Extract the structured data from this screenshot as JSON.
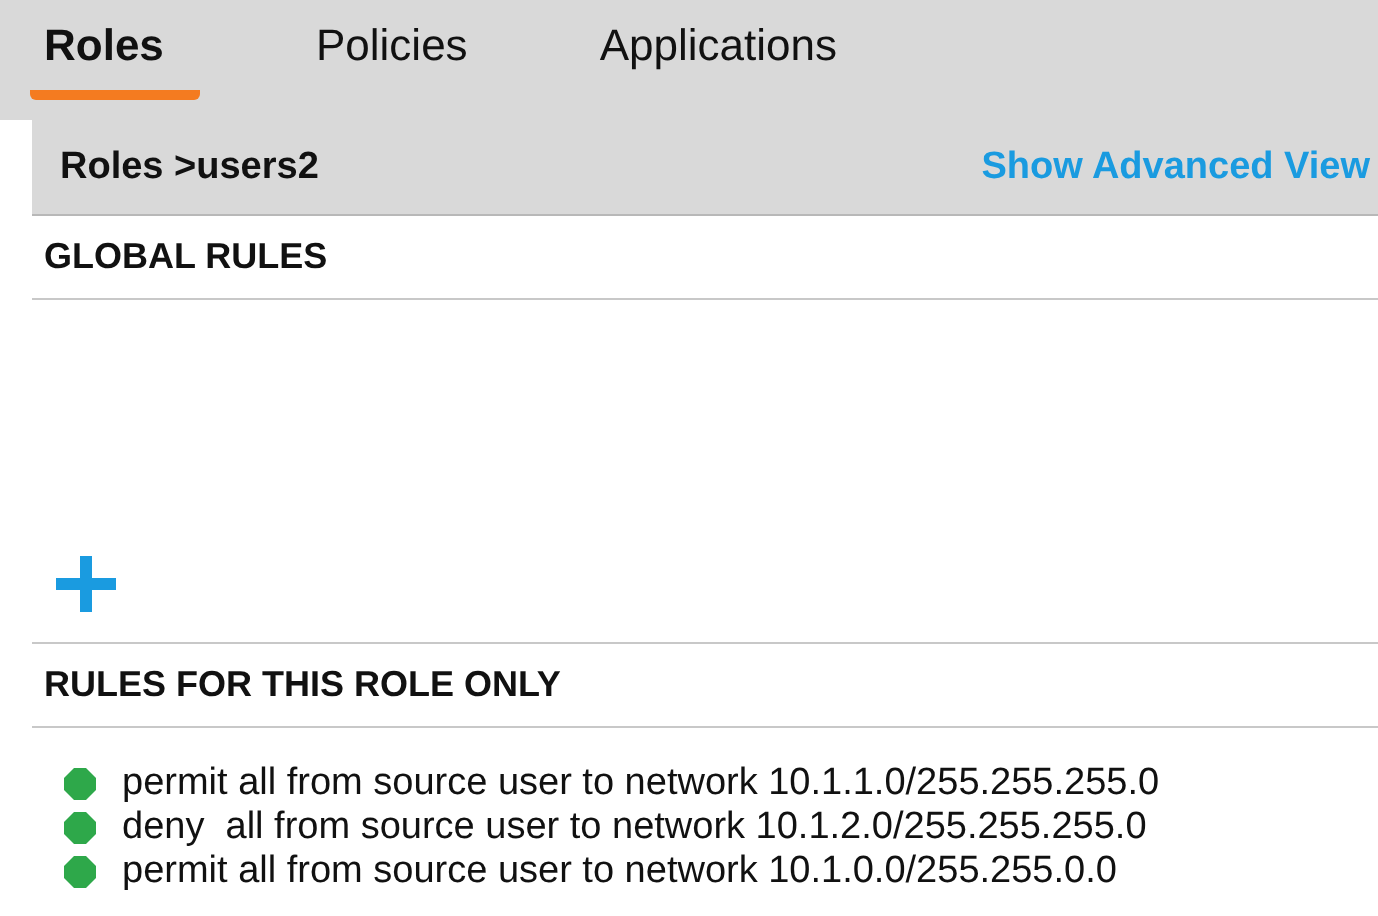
{
  "tabs": [
    {
      "label": "Roles",
      "selected": true
    },
    {
      "label": "Policies",
      "selected": false
    },
    {
      "label": "Applications",
      "selected": false
    }
  ],
  "breadcrumb": "Roles >users2",
  "advanced_link": "Show Advanced View",
  "global_rules": {
    "title": "GLOBAL RULES"
  },
  "role_rules": {
    "title": "RULES FOR THIS ROLE ONLY",
    "rules": [
      {
        "text": "permit all from source user to network 10.1.1.0/255.255.255.0"
      },
      {
        "text": "deny  all from source user to network 10.1.2.0/255.255.255.0"
      },
      {
        "text": "permit all from source user to network 10.1.0.0/255.255.0.0"
      }
    ]
  }
}
